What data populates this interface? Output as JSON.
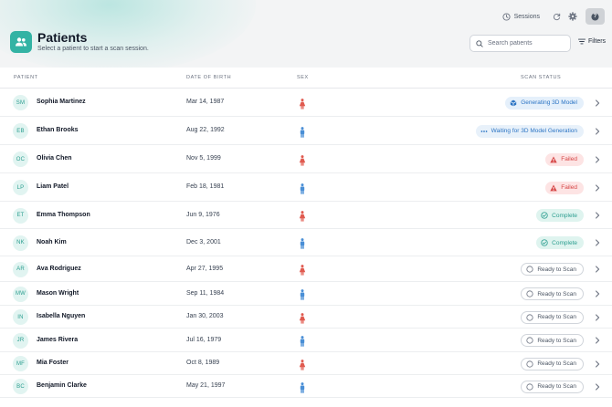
{
  "header": {
    "title": "Patients",
    "subtitle": "Select a patient to start a scan session.",
    "sessions_label": "Sessions",
    "help_label": "?",
    "search_placeholder": "Search patients",
    "filters_label": "Filters"
  },
  "columns": {
    "patient": "PATIENT",
    "dob": "DATE OF BIRTH",
    "sex": "SEX",
    "scan_status": "SCAN STATUS"
  },
  "colors": {
    "accent": "#33b3a4",
    "female": "#e05a4f",
    "male": "#4a8fd6",
    "failed": "#d64545",
    "complete": "#2a9d8f",
    "generating": "#2b74c4"
  },
  "patients": [
    {
      "initials": "SM",
      "name": "Sophia Martinez",
      "dob": "Mar 14, 1987",
      "sex": "female",
      "status": "Generating 3D Model",
      "status_kind": "generating",
      "status_icon": "cube-icon"
    },
    {
      "initials": "EB",
      "name": "Ethan Brooks",
      "dob": "Aug 22, 1992",
      "sex": "male",
      "status": "Waiting for 3D Model Generation",
      "status_kind": "waiting",
      "status_icon": "dots-icon"
    },
    {
      "initials": "OC",
      "name": "Olivia Chen",
      "dob": "Nov 5, 1999",
      "sex": "female",
      "status": "Failed",
      "status_kind": "failed",
      "status_icon": "warning-icon"
    },
    {
      "initials": "LP",
      "name": "Liam Patel",
      "dob": "Feb 18, 1981",
      "sex": "male",
      "status": "Failed",
      "status_kind": "failed",
      "status_icon": "warning-icon"
    },
    {
      "initials": "ET",
      "name": "Emma Thompson",
      "dob": "Jun 9, 1976",
      "sex": "female",
      "status": "Complete",
      "status_kind": "complete",
      "status_icon": "check-circle-icon"
    },
    {
      "initials": "NK",
      "name": "Noah Kim",
      "dob": "Dec 3, 2001",
      "sex": "male",
      "status": "Complete",
      "status_kind": "complete",
      "status_icon": "check-circle-icon"
    },
    {
      "initials": "AR",
      "name": "Ava Rodriguez",
      "dob": "Apr 27, 1995",
      "sex": "female",
      "status": "Ready to Scan",
      "status_kind": "ready",
      "status_icon": "circle-icon"
    },
    {
      "initials": "MW",
      "name": "Mason Wright",
      "dob": "Sep 11, 1984",
      "sex": "male",
      "status": "Ready to Scan",
      "status_kind": "ready",
      "status_icon": "circle-icon"
    },
    {
      "initials": "IN",
      "name": "Isabella Nguyen",
      "dob": "Jan 30, 2003",
      "sex": "female",
      "status": "Ready to Scan",
      "status_kind": "ready",
      "status_icon": "circle-icon"
    },
    {
      "initials": "JR",
      "name": "James Rivera",
      "dob": "Jul 16, 1979",
      "sex": "male",
      "status": "Ready to Scan",
      "status_kind": "ready",
      "status_icon": "circle-icon"
    },
    {
      "initials": "MF",
      "name": "Mia Foster",
      "dob": "Oct 8, 1989",
      "sex": "female",
      "status": "Ready to Scan",
      "status_kind": "ready",
      "status_icon": "circle-icon"
    },
    {
      "initials": "BC",
      "name": "Benjamin Clarke",
      "dob": "May 21, 1997",
      "sex": "male",
      "status": "Ready to Scan",
      "status_kind": "ready",
      "status_icon": "circle-icon"
    }
  ]
}
